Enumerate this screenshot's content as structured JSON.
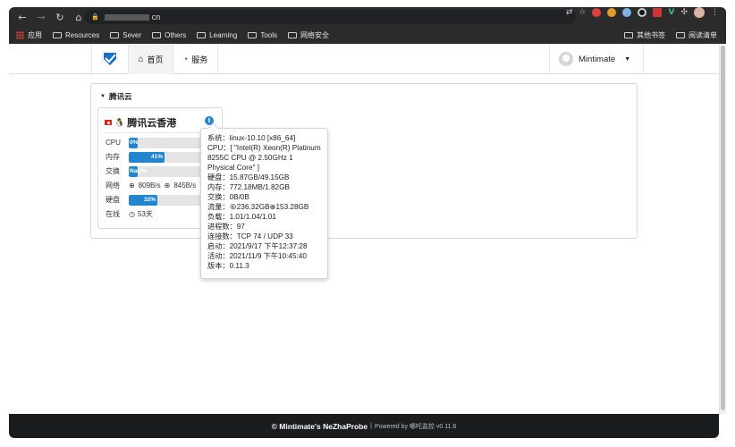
{
  "browser": {
    "url_suffix": "cn",
    "bookmarks": [
      {
        "label": "应用"
      },
      {
        "label": "Resources"
      },
      {
        "label": "Sever"
      },
      {
        "label": "Others"
      },
      {
        "label": "Learning"
      },
      {
        "label": "Tools"
      },
      {
        "label": "网络安全"
      }
    ],
    "other_bookmarks": "其他书签",
    "reading_list": "阅读清单"
  },
  "nav": {
    "home": "首页",
    "services": "服务",
    "user": "Mintimate"
  },
  "group": {
    "title": "腾讯云"
  },
  "server": {
    "name": "腾讯云香港",
    "info_icon": "i",
    "cpu_label": "CPU",
    "cpu_percent": 0,
    "cpu_text": "0%",
    "mem_label": "内存",
    "mem_percent": 41,
    "mem_text": "41%",
    "swap_label": "交换",
    "swap_percent": 0,
    "swap_text": "NaN%",
    "net_label": "网络",
    "net_in": "809B/s",
    "net_out": "845B/s",
    "disk_label": "硬盘",
    "disk_percent": 32,
    "disk_text": "32%",
    "online_label": "在线",
    "online_value": "53天"
  },
  "tooltip": {
    "system": "系统：linux-10.10 [x86_64]",
    "cpu": "CPU：[ \"Intel(R) Xeon(R) Platinum 8255C CPU @ 2.50GHz 1 Physical Core\" ]",
    "disk": "硬盘：15.87GB/49.15GB",
    "memory": "内存：772.18MB/1.82GB",
    "swap": "交换：0B/0B",
    "traffic": "流量：⊕236.32GB⊕153.28GB",
    "load": "负载：1.01/1.04/1.01",
    "processes": "进程数：97",
    "connections": "连接数：TCP 74 / UDP 33",
    "boot": "启动：2021/9/17 下午12:37:28",
    "active": "活动：2021/11/9 下午10:45:40",
    "version": "版本：0.11.3"
  },
  "footer": {
    "copyright": "© Mintimate's NeZhaProbe",
    "separator": "|",
    "powered": "Powered by 哪吒监控 v0.11.6"
  },
  "colors": {
    "accent": "#2185d0",
    "footer_bg": "#1b1c1d"
  }
}
